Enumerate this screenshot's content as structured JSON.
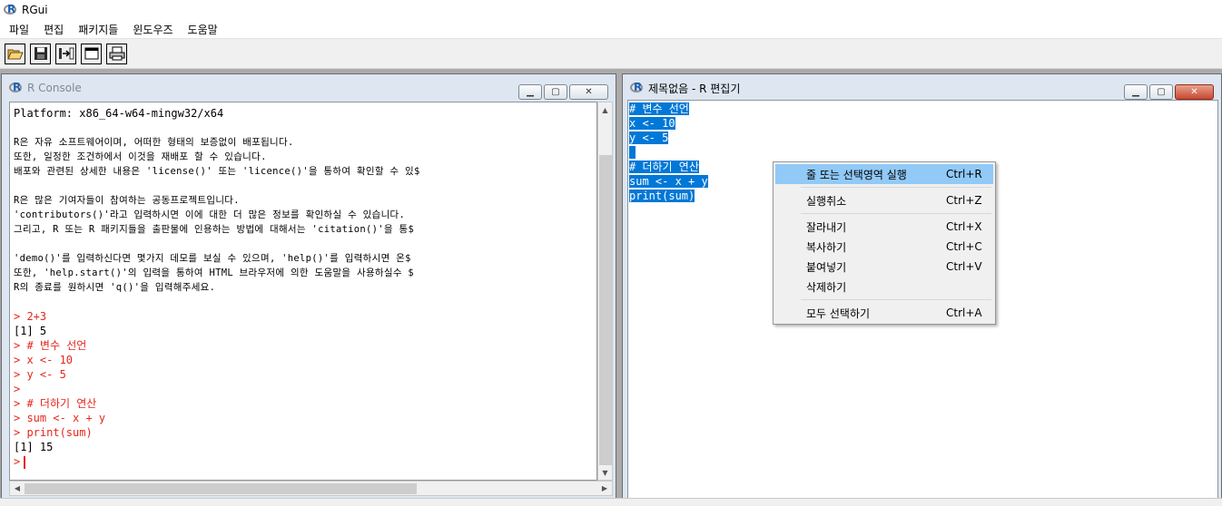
{
  "app": {
    "title": "RGui",
    "logo_letter": "R"
  },
  "menubar": [
    "파일",
    "편집",
    "패키지들",
    "윈도우즈",
    "도움말"
  ],
  "toolbar": [
    "open-script-icon",
    "save-icon",
    "load-workspace-icon",
    "window-icon",
    "print-icon"
  ],
  "console": {
    "title": "R Console",
    "lines": [
      {
        "text": "Platform: x86_64-w64-mingw32/x64",
        "style": "normal"
      },
      {
        "text": "",
        "style": "blank"
      },
      {
        "text": "R은 자유 소프트웨어이며, 어떠한 형태의 보증없이 배포됩니다.",
        "style": "small"
      },
      {
        "text": "또한, 일정한 조건하에서 이것을 재배포 할 수 있습니다.",
        "style": "small"
      },
      {
        "text": "배포와 관련된 상세한 내용은 'license()' 또는 'licence()'을 통하여 확인할 수 있$",
        "style": "small"
      },
      {
        "text": "",
        "style": "blank"
      },
      {
        "text": "R은 많은 기여자들이 참여하는 공동프로젝트입니다.",
        "style": "small"
      },
      {
        "text": "'contributors()'라고 입력하시면 이에 대한 더 많은 정보를 확인하실 수 있습니다.",
        "style": "small"
      },
      {
        "text": "그리고, R 또는 R 패키지들을 출판물에 인용하는 방법에 대해서는 'citation()'을 통$",
        "style": "small"
      },
      {
        "text": "",
        "style": "blank"
      },
      {
        "text": "'demo()'를 입력하신다면 몇가지 데모를 보실 수 있으며, 'help()'를 입력하시면 온$",
        "style": "small"
      },
      {
        "text": "또한, 'help.start()'의 입력을 통하여 HTML 브라우저에 의한 도움말을 사용하실수 $",
        "style": "small"
      },
      {
        "text": "R의 종료를 원하시면 'q()'을 입력해주세요.",
        "style": "small"
      },
      {
        "text": "",
        "style": "blank"
      },
      {
        "text": "> 2+3",
        "style": "red"
      },
      {
        "text": "[1] 5",
        "style": "normal"
      },
      {
        "text": "> # 변수 선언",
        "style": "red"
      },
      {
        "text": "> x <- 10",
        "style": "red"
      },
      {
        "text": "> y <- 5",
        "style": "red"
      },
      {
        "text": ">",
        "style": "red"
      },
      {
        "text": "> # 더하기 연산",
        "style": "red"
      },
      {
        "text": "> sum <- x + y",
        "style": "red"
      },
      {
        "text": "> print(sum)",
        "style": "red"
      },
      {
        "text": "[1] 15",
        "style": "normal"
      }
    ],
    "prompt": ">"
  },
  "editor": {
    "title": "제목없음 - R 편집기",
    "lines": [
      "# 변수 선언",
      "x <- 10",
      "y <- 5",
      " ",
      "# 더하기 연산",
      "sum <- x + y",
      "print(sum)"
    ]
  },
  "context_menu": {
    "groups": [
      [
        {
          "label": "줄 또는 선택영역 실행",
          "shortcut": "Ctrl+R",
          "highlighted": true
        }
      ],
      [
        {
          "label": "실행취소",
          "shortcut": "Ctrl+Z"
        }
      ],
      [
        {
          "label": "잘라내기",
          "shortcut": "Ctrl+X"
        },
        {
          "label": "복사하기",
          "shortcut": "Ctrl+C"
        },
        {
          "label": "붙여넣기",
          "shortcut": "Ctrl+V"
        },
        {
          "label": "삭제하기",
          "shortcut": ""
        }
      ],
      [
        {
          "label": "모두 선택하기",
          "shortcut": "Ctrl+A"
        }
      ]
    ]
  }
}
